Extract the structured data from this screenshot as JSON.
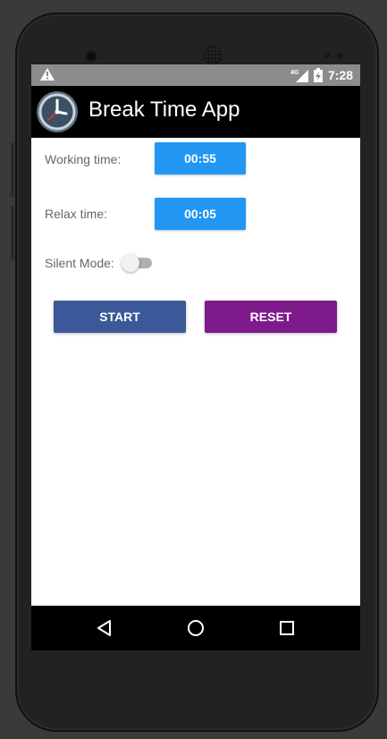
{
  "status_bar": {
    "time": "7:28",
    "network": "4G",
    "icons": [
      "warning-icon",
      "signal-icon",
      "battery-charging-icon"
    ]
  },
  "app_bar": {
    "title": "Break Time App",
    "logo_icon": "clock-icon"
  },
  "settings": {
    "working_label": "Working time:",
    "working_value": "00:55",
    "relax_label": "Relax time:",
    "relax_value": "00:05",
    "silent_label": "Silent Mode:",
    "silent_on": false
  },
  "actions": {
    "start_label": "START",
    "reset_label": "RESET"
  },
  "nav_bar": {
    "icons": [
      "back-icon",
      "home-icon",
      "recents-icon"
    ]
  },
  "colors": {
    "status_bar": "#8c8c8c",
    "app_bar": "#000000",
    "time_button": "#2196f3",
    "start_button": "#3b5998",
    "reset_button": "#7e1a8c"
  }
}
